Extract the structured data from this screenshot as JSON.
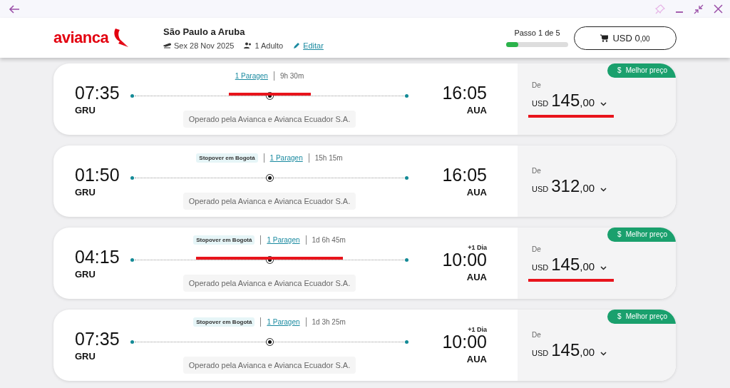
{
  "header": {
    "logo": "avianca",
    "route": "São Paulo a Aruba",
    "date": "Sex 28 Nov 2025",
    "passengers": "1 Adulto",
    "edit": "Editar",
    "progress": {
      "label": "Passo 1 de 5",
      "level": 0.2
    },
    "cart": {
      "currency": "USD",
      "amount": "0",
      "cents": ",00"
    }
  },
  "flights": [
    {
      "stops": "1 Paragen",
      "duration": "9h 30m",
      "depart_time": "07:35",
      "depart_code": "GRU",
      "arrive_time": "16:05",
      "arrive_code": "AUA",
      "operator": "Operado pela Avianca e Avianca Ecuador S.A.",
      "from_label": "De",
      "currency": "USD",
      "amount": "145",
      "cents": ",00",
      "badge": {
        "icon": "$",
        "label": "Melhor preço"
      },
      "annotated": true
    },
    {
      "stopover": "Stopover em Bogotá",
      "stops": "1 Paragen",
      "duration": "15h 15m",
      "depart_time": "01:50",
      "depart_code": "GRU",
      "arrive_time": "16:05",
      "arrive_code": "AUA",
      "operator": "Operado pela Avianca e Avianca Ecuador S.A.",
      "from_label": "De",
      "currency": "USD",
      "amount": "312",
      "cents": ",00",
      "annotated": false
    },
    {
      "stopover": "Stopover em Bogotá",
      "stops": "1 Paragen",
      "duration": "1d 6h 45m",
      "depart_time": "04:15",
      "depart_code": "GRU",
      "arrive_time": "10:00",
      "arrive_code": "AUA",
      "day_offset": "+1 Dia",
      "operator": "Operado pela Avianca e Avianca Ecuador S.A.",
      "from_label": "De",
      "currency": "USD",
      "amount": "145",
      "cents": ",00",
      "badge": {
        "icon": "$",
        "label": "Melhor preço"
      },
      "annotated": true
    },
    {
      "stopover": "Stopover em Bogotá",
      "stops": "1 Paragen",
      "duration": "1d 3h 25m",
      "depart_time": "07:35",
      "depart_code": "GRU",
      "arrive_time": "10:00",
      "arrive_code": "AUA",
      "day_offset": "+1 Dia",
      "operator": "Operado pela Avianca e Avianca Ecuador S.A.",
      "from_label": "De",
      "currency": "USD",
      "amount": "145",
      "cents": ",00",
      "badge": {
        "icon": "$",
        "label": "Melhor preço"
      },
      "annotated": false
    }
  ]
}
